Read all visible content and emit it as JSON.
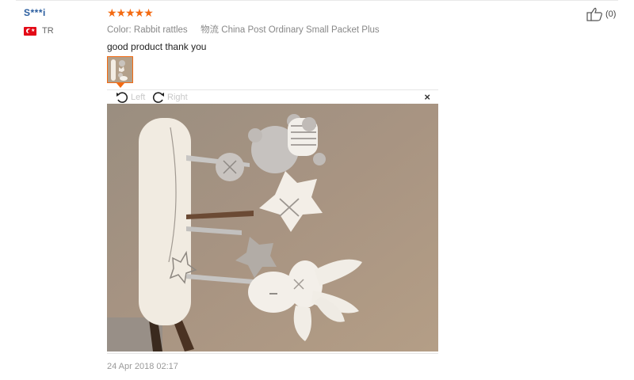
{
  "user": {
    "name": "S***i",
    "country": "TR"
  },
  "review": {
    "stars": "★★★★★",
    "color_label": "Color:",
    "color_value": "Rabbit rattles",
    "shipping_label": "物流",
    "shipping_value": "China Post Ordinary Small Packet Plus",
    "text": "good product thank you",
    "date": "24 Apr 2018 02:17"
  },
  "viewer": {
    "rotate_left": "Left",
    "rotate_right": "Right",
    "close": "×"
  },
  "helpful": {
    "count": "(0)"
  },
  "colors": {
    "name_link": "#2a5d9f",
    "stars": "#f36a12",
    "thumb_border": "#f36a12"
  },
  "icons": [
    "turkey-flag-icon",
    "rotate-left-icon",
    "rotate-right-icon",
    "close-icon",
    "thumbs-up-icon"
  ]
}
